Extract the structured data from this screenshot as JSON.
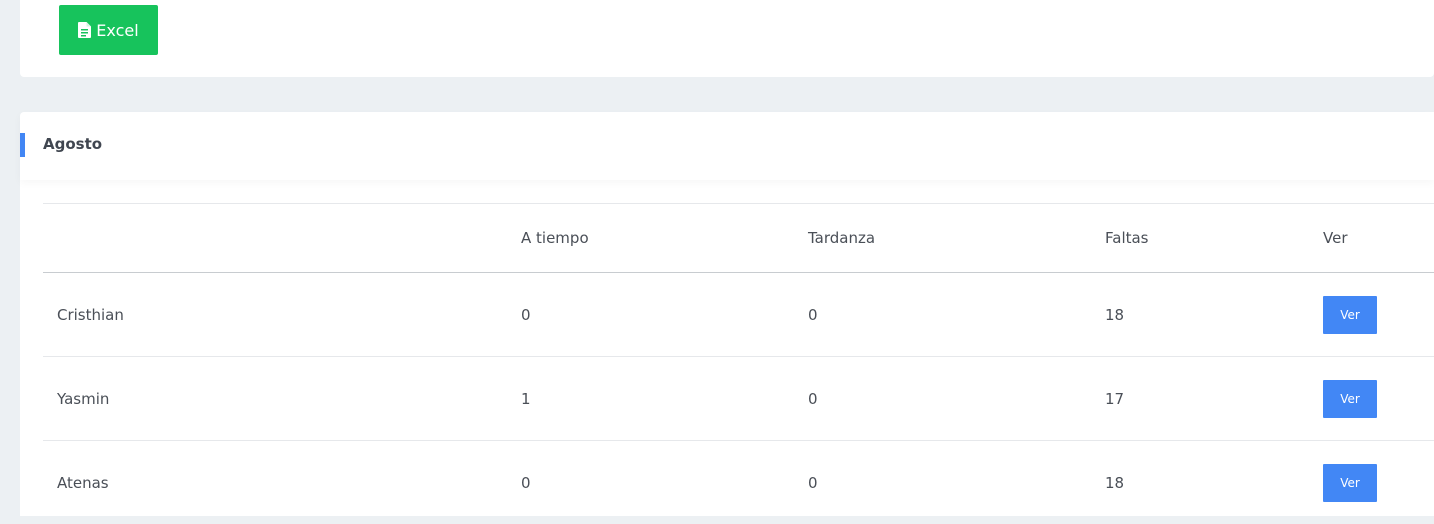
{
  "toolbar": {
    "excel_label": "Excel",
    "excel_icon": "file-spreadsheet-icon",
    "excel_color": "#17c35c"
  },
  "card": {
    "title": "Agosto",
    "accent_color": "#4286f4"
  },
  "table": {
    "headers": [
      "",
      "A tiempo",
      "Tardanza",
      "Faltas",
      "Ver"
    ],
    "rows": [
      {
        "name": "Cristhian",
        "a_tiempo": "0",
        "tardanza": "0",
        "faltas": "18",
        "action": "Ver"
      },
      {
        "name": "Yasmin",
        "a_tiempo": "1",
        "tardanza": "0",
        "faltas": "17",
        "action": "Ver"
      },
      {
        "name": "Atenas",
        "a_tiempo": "0",
        "tardanza": "0",
        "faltas": "18",
        "action": "Ver"
      }
    ],
    "action_color": "#4287f5"
  }
}
